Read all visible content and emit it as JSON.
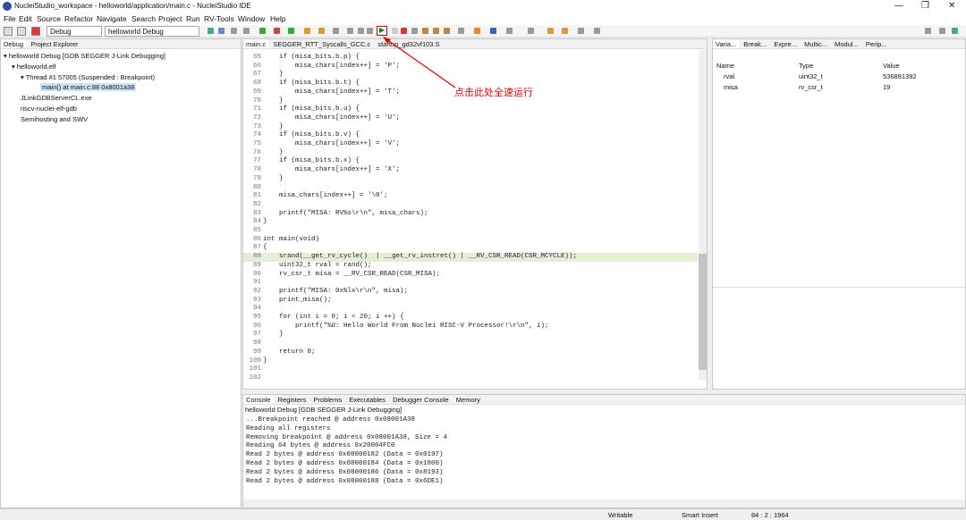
{
  "window": {
    "title": "NucleiStudio_workspace - helloworld/application/main.c - NucleiStudio IDE",
    "controls": [
      "—",
      "❐",
      "✕"
    ]
  },
  "menu": [
    "File",
    "Edit",
    "Source",
    "Refactor",
    "Navigate",
    "Search",
    "Project",
    "Run",
    "RV-Tools",
    "Window",
    "Help"
  ],
  "toolbar": {
    "run_mode": "Debug",
    "launch_config": "helloworld Debug",
    "resume_icon": "resume-icon"
  },
  "debug_view": {
    "tabs": [
      "Debug",
      "Project Explorer"
    ],
    "items": [
      "helloworld Debug [GDB SEGGER J-Link Debugging]",
      "helloworld.elf",
      "Thread #1 57005 (Suspended : Breakpoint)",
      "main() at main.c:88 0x8001a38",
      "JLinkGDBServerCL.exe",
      "riscv-nuclei-elf-gdb",
      "Semihosting and SWV"
    ]
  },
  "editor": {
    "tabs": [
      "main.c",
      "SEGGER_RTT_Syscalls_GCC.c",
      "startup_gd32vf103.S"
    ],
    "lines": [
      {
        "n": "65",
        "t": "    if (misa_bits.b.p) {"
      },
      {
        "n": "66",
        "t": "        misa_chars[index++] = 'P';"
      },
      {
        "n": "67",
        "t": "    }"
      },
      {
        "n": "68",
        "t": "    if (misa_bits.b.t) {"
      },
      {
        "n": "69",
        "t": "        misa_chars[index++] = 'T';"
      },
      {
        "n": "70",
        "t": "    }"
      },
      {
        "n": "71",
        "t": "    if (misa_bits.b.u) {"
      },
      {
        "n": "72",
        "t": "        misa_chars[index++] = 'U';"
      },
      {
        "n": "73",
        "t": "    }"
      },
      {
        "n": "74",
        "t": "    if (misa_bits.b.v) {"
      },
      {
        "n": "75",
        "t": "        misa_chars[index++] = 'V';"
      },
      {
        "n": "76",
        "t": "    }"
      },
      {
        "n": "77",
        "t": "    if (misa_bits.b.x) {"
      },
      {
        "n": "78",
        "t": "        misa_chars[index++] = 'X';"
      },
      {
        "n": "79",
        "t": "    }"
      },
      {
        "n": "80",
        "t": ""
      },
      {
        "n": "81",
        "t": "    misa_chars[index++] = '\\0';"
      },
      {
        "n": "82",
        "t": ""
      },
      {
        "n": "83",
        "t": "    printf(\"MISA: RV%s\\r\\n\", misa_chars);"
      },
      {
        "n": "84",
        "t": "}"
      },
      {
        "n": "85",
        "t": ""
      },
      {
        "n": "86",
        "t": "int main(void)"
      },
      {
        "n": "87",
        "t": "{"
      },
      {
        "n": "88",
        "t": "    srand(__get_rv_cycle()  | __get_rv_instret() | __RV_CSR_READ(CSR_MCYCLE));"
      },
      {
        "n": "89",
        "t": "    uint32_t rval = rand();"
      },
      {
        "n": "90",
        "t": "    rv_csr_t misa = __RV_CSR_READ(CSR_MISA);"
      },
      {
        "n": "91",
        "t": ""
      },
      {
        "n": "92",
        "t": "    printf(\"MISA: 0x%lx\\r\\n\", misa);"
      },
      {
        "n": "93",
        "t": "    print_misa();"
      },
      {
        "n": "94",
        "t": ""
      },
      {
        "n": "95",
        "t": "    for (int i = 0; i < 20; i ++) {"
      },
      {
        "n": "96",
        "t": "        printf(\"%d: Hello World From Nuclei RISC-V Processor!\\r\\n\", i);"
      },
      {
        "n": "97",
        "t": "    }"
      },
      {
        "n": "98",
        "t": ""
      },
      {
        "n": "99",
        "t": "    return 0;"
      },
      {
        "n": "100",
        "t": "}"
      },
      {
        "n": "101",
        "t": ""
      },
      {
        "n": "102",
        "t": ""
      }
    ],
    "highlight_line": "88"
  },
  "variables": {
    "tabs": [
      "Varia...",
      "Break...",
      "Expre...",
      "Multic...",
      "Modul...",
      "Perip..."
    ],
    "headers": [
      "Name",
      "Type",
      "Value"
    ],
    "rows": [
      {
        "name": "rval",
        "type": "uint32_t",
        "value": "536891392"
      },
      {
        "name": "misa",
        "type": "rv_csr_t",
        "value": "19"
      }
    ]
  },
  "console": {
    "tabs": [
      "Console",
      "Registers",
      "Problems",
      "Executables",
      "Debugger Console",
      "Memory"
    ],
    "subtitle": "helloworld Debug [GDB SEGGER J-Link Debugging]",
    "lines": [
      "...Breakpoint reached @ address 0x08001A38",
      "Reading all registers",
      "Removing breakpoint @ address 0x08001A38, Size = 4",
      "Reading 64 bytes @ address 0x20004FC0",
      "Read 2 bytes @ address 0x08000182 (Data = 0x0197)",
      "Read 2 bytes @ address 0x08000184 (Data = 0x1800)",
      "Read 2 bytes @ address 0x08000186 (Data = 0x8193)",
      "Read 2 bytes @ address 0x08000188 (Data = 0x6DE1)"
    ]
  },
  "annotation": "点击此处全速运行",
  "status": {
    "writable": "Writable",
    "insert": "Smart Insert",
    "position": "84 : 2 : 1964"
  },
  "colors": {
    "annotation": "#e00000",
    "highlight": "#e4f0d6",
    "keyword": "#7f0055"
  }
}
